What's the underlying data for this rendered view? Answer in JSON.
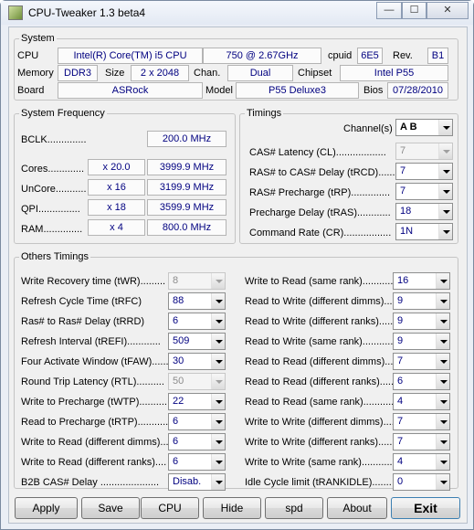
{
  "window": {
    "title": "CPU-Tweaker 1.3 beta4",
    "minimize": "—",
    "maximize": "☐",
    "close": "✕"
  },
  "system": {
    "title": "System",
    "cpu_label": "CPU",
    "cpu_name": "Intel(R) Core(TM) i5 CPU",
    "cpu_model": "750  @ 2.67GHz",
    "cpuid_label": "cpuid",
    "cpuid": "6E5",
    "rev_label": "Rev.",
    "rev": "B1",
    "memory_label": "Memory",
    "memory": "DDR3",
    "size_label": "Size",
    "size": "2 x 2048",
    "chan_label": "Chan.",
    "chan": "Dual",
    "chipset_label": "Chipset",
    "chipset": "Intel P55",
    "board_label": "Board",
    "board": "ASRock",
    "model_label": "Model",
    "model": "P55 Deluxe3",
    "bios_label": "Bios",
    "bios": "07/28/2010"
  },
  "freq": {
    "title": "System Frequency",
    "bclk_label": "BCLK..............",
    "bclk": "200.0 MHz",
    "rows": [
      {
        "label": "Cores.............",
        "mult": "x 20.0",
        "value": "3999.9 MHz"
      },
      {
        "label": "UnCore...........",
        "mult": "x 16",
        "value": "3199.9 MHz"
      },
      {
        "label": "QPI...............",
        "mult": "x 18",
        "value": "3599.9 MHz"
      },
      {
        "label": "RAM..............",
        "mult": "x 4",
        "value": "800.0 MHz"
      }
    ]
  },
  "timings": {
    "title": "Timings",
    "channels_label": "Channel(s)",
    "channels": "A  B",
    "rows": [
      {
        "label": "CAS# Latency (CL)..................",
        "value": "7"
      },
      {
        "label": "RAS# to CAS# Delay (tRCD).......",
        "value": "7"
      },
      {
        "label": "RAS# Precharge (tRP)..............",
        "value": "7"
      },
      {
        "label": "Precharge Delay (tRAS)............",
        "value": "18"
      },
      {
        "label": "Command Rate (CR).................",
        "value": "1N"
      }
    ]
  },
  "others": {
    "title": "Others Timings",
    "left": [
      {
        "label": "Write Recovery time (tWR).........",
        "value": "8"
      },
      {
        "label": "Refresh Cycle Time (tRFC)",
        "value": "88"
      },
      {
        "label": "Ras# to Ras# Delay (tRRD)",
        "value": "6"
      },
      {
        "label": "Refresh Interval (tREFI)............",
        "value": "509"
      },
      {
        "label": "Four Activate Window (tFAW)......",
        "value": "30"
      },
      {
        "label": "Round Trip Latency (RTL)..........",
        "value": "50"
      },
      {
        "label": "Write to Precharge (tWTP)..........",
        "value": "22"
      },
      {
        "label": "Read to Precharge (tRTP)...........",
        "value": "6"
      },
      {
        "label": "Write to Read (different dimms)...",
        "value": "6"
      },
      {
        "label": "Write to Read (different ranks)....",
        "value": "6"
      },
      {
        "label": "B2B CAS# Delay .....................",
        "value": "Disab."
      }
    ],
    "right": [
      {
        "label": "Write to Read (same rank)...........",
        "value": "16"
      },
      {
        "label": "Read to Write (different dimms)....",
        "value": "9"
      },
      {
        "label": "Read to Write (different ranks).....",
        "value": "9"
      },
      {
        "label": "Read to Write (same rank)............",
        "value": "9"
      },
      {
        "label": "Read to Read (different dimms).....",
        "value": "7"
      },
      {
        "label": "Read to Read (different ranks)......",
        "value": "6"
      },
      {
        "label": "Read to Read (same rank).............",
        "value": "4"
      },
      {
        "label": "Write to Write (different dimms)....",
        "value": "7"
      },
      {
        "label": "Write to Write (different ranks).....",
        "value": "7"
      },
      {
        "label": "Write to Write (same rank)...........",
        "value": "4"
      },
      {
        "label": "Idle Cycle limit (tRANKIDLE).......",
        "value": "0"
      }
    ]
  },
  "buttons": {
    "apply": "Apply",
    "save": "Save",
    "cpu": "CPU",
    "hide": "Hide",
    "spd": "spd",
    "about": "About",
    "exit": "Exit"
  }
}
